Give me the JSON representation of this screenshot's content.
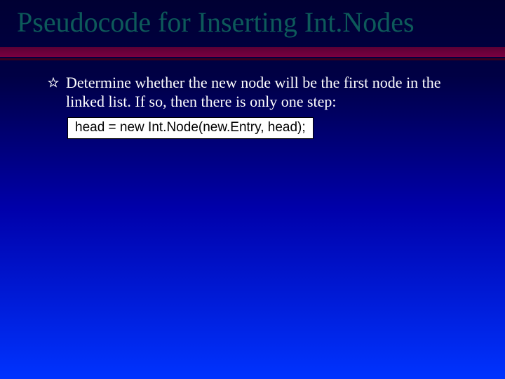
{
  "title": "Pseudocode for Inserting Int.Nodes",
  "bullet": {
    "text": "Determine whether the new node will be the first node in the linked list.  If so, then there is only one step:"
  },
  "code": "head = new Int.Node(new.Entry, head);",
  "icons": {
    "bullet_star": "hollow-star-icon"
  },
  "colors": {
    "title": "#0d5a5a",
    "rule_primary": "#6a003a",
    "bg_top": "#000033",
    "bg_bottom": "#0033ff"
  }
}
